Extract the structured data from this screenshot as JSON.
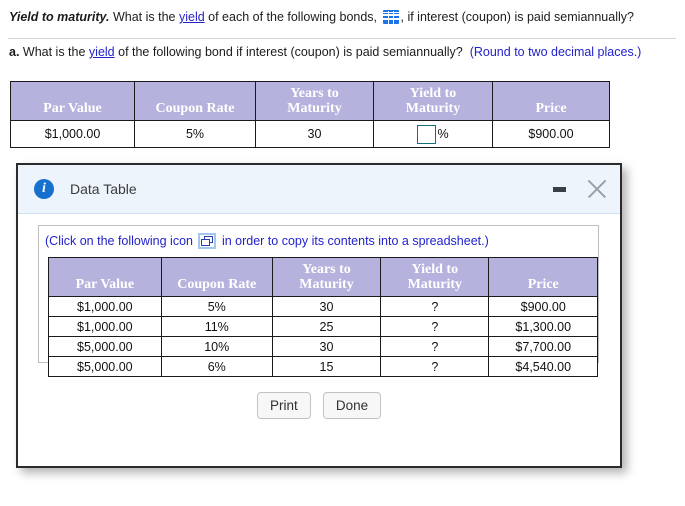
{
  "question": {
    "title": "Yield to maturity.",
    "line1_before_link": " What is the ",
    "link_text": "yield",
    "line1_after_link": " of each of the following bonds, ",
    "line1_tail": ", if interest (coupon) is paid semiannually?",
    "grid_icon": "grid-table-icon",
    "part_label": "a.",
    "part_before_link": " What is the ",
    "part_link": "yield",
    "part_after_link": " of the following bond if interest (coupon) is paid semiannually?",
    "round_note": "(Round to two decimal places.)"
  },
  "top_table": {
    "headers": [
      "Par Value",
      "Coupon Rate",
      "Years to Maturity",
      "Yield to Maturity",
      "Price"
    ],
    "header_lines": [
      [
        "",
        "Par Value"
      ],
      [
        "",
        "Coupon Rate"
      ],
      [
        "Years to",
        "Maturity"
      ],
      [
        "Yield to",
        "Maturity"
      ],
      [
        "",
        "Price"
      ]
    ],
    "row": {
      "par_value": "$1,000.00",
      "coupon_rate": "5%",
      "years_to_maturity": "30",
      "yield_value": "",
      "yield_placeholder": "",
      "percent_sign": "%",
      "price": "$900.00"
    }
  },
  "dialog": {
    "title": "Data Table",
    "info_icon_glyph": "i",
    "minimize_label": "minimize",
    "close_label": "close",
    "copy_note_before": "(Click on the following icon ",
    "copy_note_after": " in order to copy its contents into a spreadsheet.)",
    "copy_icon": "copy-to-spreadsheet-icon",
    "table": {
      "headers": [
        "Par Value",
        "Coupon Rate",
        "Years to Maturity",
        "Yield to Maturity",
        "Price"
      ],
      "header_lines": [
        [
          "",
          "Par Value"
        ],
        [
          "",
          "Coupon Rate"
        ],
        [
          "Years to",
          "Maturity"
        ],
        [
          "Yield to",
          "Maturity"
        ],
        [
          "",
          "Price"
        ]
      ],
      "rows": [
        [
          "$1,000.00",
          "5%",
          "30",
          "?",
          "$900.00"
        ],
        [
          "$1,000.00",
          "11%",
          "25",
          "?",
          "$1,300.00"
        ],
        [
          "$5,000.00",
          "10%",
          "30",
          "?",
          "$7,700.00"
        ],
        [
          "$5,000.00",
          "6%",
          "15",
          "?",
          "$4,540.00"
        ]
      ]
    },
    "buttons": {
      "print": "Print",
      "done": "Done"
    }
  },
  "colors": {
    "table_header_bg": "#b6b2de",
    "link": "#2222cc",
    "dialog_header_bg": "#eef4fc",
    "info_icon": "#1670d0",
    "input_border": "#12707e",
    "grid_icon": "#1a73e8"
  }
}
